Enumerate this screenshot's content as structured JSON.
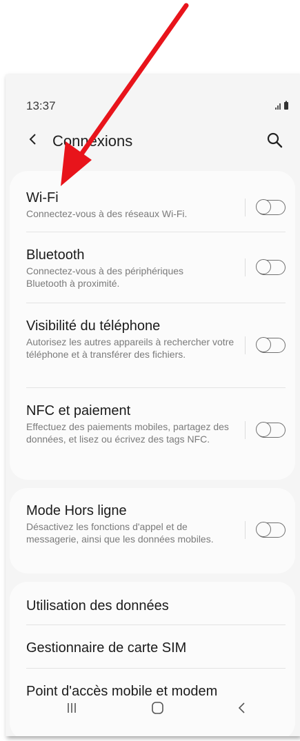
{
  "status_bar": {
    "time": "13:37",
    "icons": ".ıl ▮"
  },
  "header": {
    "title": "Connexions"
  },
  "section1": [
    {
      "title": "Wi-Fi",
      "desc": "Connectez-vous à des réseaux Wi-Fi."
    },
    {
      "title": "Bluetooth",
      "desc": "Connectez-vous à des périphériques Bluetooth à proximité."
    },
    {
      "title": "Visibilité du téléphone",
      "desc": "Autorisez les autres appareils à rechercher votre téléphone et à transférer des fichiers."
    },
    {
      "title": "NFC et paiement",
      "desc": "Effectuez des paiements mobiles, partagez des données, et lisez ou écrivez des tags NFC."
    }
  ],
  "section2": [
    {
      "title": "Mode Hors ligne",
      "desc": "Désactivez les fonctions d'appel et de messagerie, ainsi que les données mobiles."
    }
  ],
  "section3": [
    {
      "title": "Utilisation des données"
    },
    {
      "title": "Gestionnaire de carte SIM"
    },
    {
      "title": "Point d'accès mobile et modem"
    }
  ],
  "toggles": {
    "wifi": false,
    "bluetooth": false,
    "visibility": false,
    "nfc": false,
    "airplane": false
  },
  "colors": {
    "annotation_arrow": "#e8141b",
    "background": "#f5f5f5",
    "card": "#fbfbfb"
  },
  "icons": {
    "back": "chevron-left-icon",
    "search": "search-icon",
    "nav_recent": "recent-apps-icon",
    "nav_home": "home-icon",
    "nav_back": "back-icon"
  }
}
